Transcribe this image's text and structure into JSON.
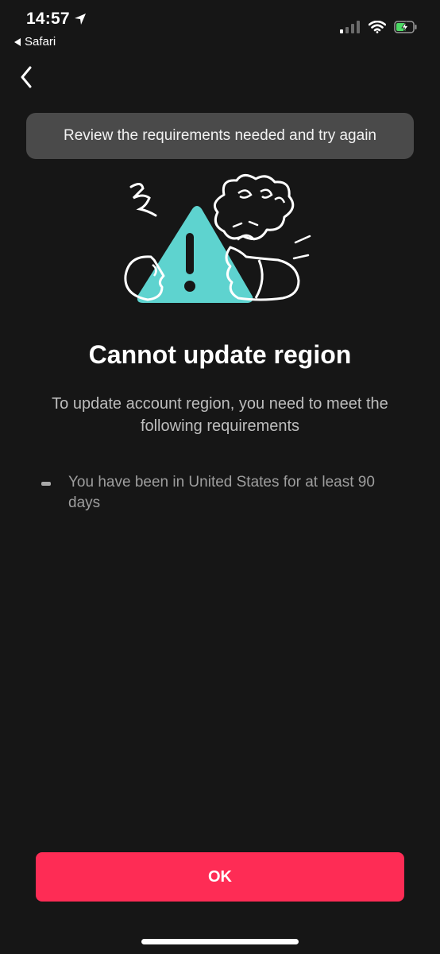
{
  "status_bar": {
    "time": "14:57",
    "back_app_label": "Safari",
    "location_icon": "location-arrow-icon",
    "signal_icon": "signal-bars-icon",
    "wifi_icon": "wifi-icon",
    "battery_icon": "battery-charging-icon",
    "battery_color": "#4cd964"
  },
  "nav": {
    "back_icon": "chevron-left-icon"
  },
  "toast": {
    "message": "Review the requirements needed and try again"
  },
  "illustration": {
    "icon": "warning-triangle-illustration",
    "accent_color": "#5ed3cf"
  },
  "content": {
    "title": "Cannot update region",
    "subtitle": "To update account region, you need to meet the following requirements",
    "requirements": [
      "You have been in United States for at least 90 days"
    ]
  },
  "actions": {
    "ok_label": "OK",
    "ok_color": "#fe2c55"
  }
}
